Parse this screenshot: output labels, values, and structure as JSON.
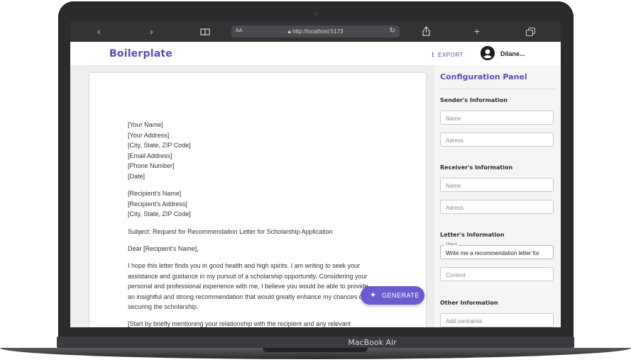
{
  "device": {
    "label": "MacBook Air"
  },
  "browser": {
    "aa_label": "AA",
    "url": "http://localhost:5173",
    "icons": [
      "back-icon",
      "forward-icon",
      "book-icon",
      "share-icon",
      "plus-icon",
      "tabs-icon",
      "lock-icon",
      "reload-icon"
    ]
  },
  "header": {
    "brand": "Boilerplate",
    "export_label": "EXPORT",
    "user_name": "Dilane..."
  },
  "letter": {
    "sender_block": [
      "[Your Name]",
      "[Your Address]",
      "[City, State, ZIP Code]",
      "[Email Address]",
      "[Phone Number]",
      "[Date]"
    ],
    "recipient_block": [
      "[Recipient's Name]",
      "[Recipient's Address]",
      "[City, State, ZIP Code]"
    ],
    "subject": "Subject: Request for Recommendation Letter for Scholarship Application",
    "greeting": "Dear [Recipient's Name],",
    "para1": [
      "I hope this letter finds you in good health and high spirits. I am writing to seek your",
      "assistance and guidance in my pursuit of a scholarship opportunity. Considering your",
      "personal and professional experience with me, I believe you would be able to provide",
      "an insightful and strong recommendation that would greatly enhance my chances of",
      "securing the scholarship."
    ],
    "para2_start": "[Start by briefly mentioning your relationship with the recipient and any relevant"
  },
  "generate_button": {
    "label": "GENERATE"
  },
  "config": {
    "title": "Configuration Panel",
    "sender_title": "Sender's Information",
    "sender_name_placeholder": "Name",
    "sender_address_placeholder": "Adress",
    "receiver_title": "Receiver's Information",
    "receiver_name_placeholder": "Name",
    "receiver_address_placeholder": "Adress",
    "letter_title": "Letter's Information",
    "object_label": "Object",
    "object_value": "Write me a recommendation letter for",
    "content_placeholder": "Content",
    "other_title": "Other Information",
    "constraints_placeholder": "Add contraints"
  },
  "colors": {
    "accent": "#5b4bb7",
    "button": "#6a5cd0"
  }
}
